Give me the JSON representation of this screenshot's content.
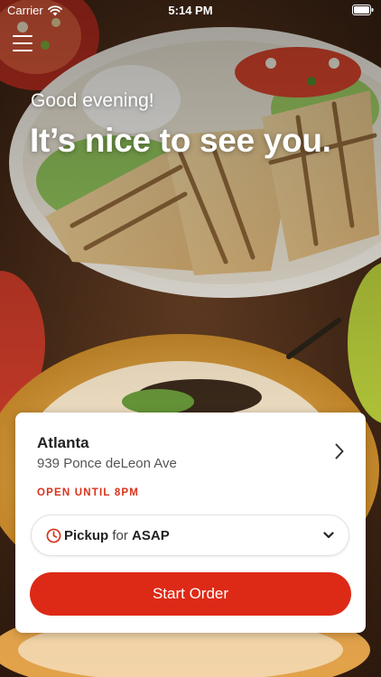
{
  "status_bar": {
    "carrier": "Carrier",
    "time": "5:14 PM",
    "wifi_icon": "wifi-icon",
    "battery_icon": "battery-icon"
  },
  "menu": {
    "icon": "hamburger-menu-icon"
  },
  "hero": {
    "greeting": "Good evening!",
    "headline": "It’s nice to see you."
  },
  "location_card": {
    "city": "Atlanta",
    "address": "939 Ponce deLeon Ave",
    "hours": "OPEN UNTIL 8PM",
    "chevron_icon": "chevron-right-icon"
  },
  "order_options": {
    "mode": "Pickup",
    "connector": "for",
    "time": "ASAP",
    "clock_icon": "clock-icon",
    "dropdown_icon": "chevron-down-icon"
  },
  "actions": {
    "start_order_label": "Start Order"
  },
  "colors": {
    "accent_red": "#dd2a17",
    "hours_red": "#d8331c",
    "card_bg": "#ffffff"
  }
}
